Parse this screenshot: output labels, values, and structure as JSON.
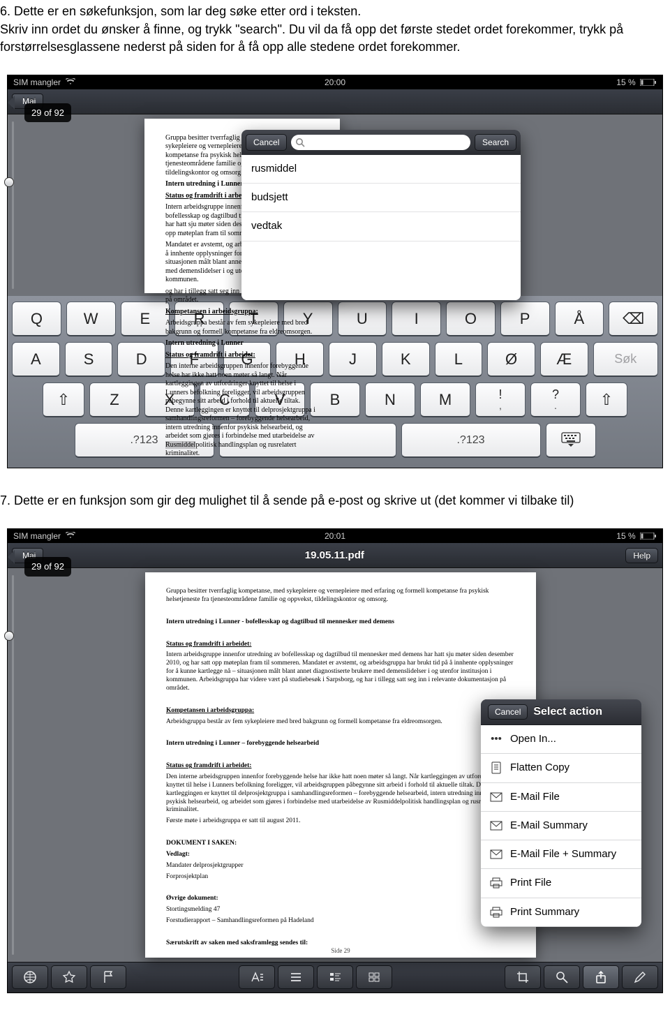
{
  "intro": {
    "line1": "6. Dette er en søkefunksjon, som lar deg søke etter ord i teksten.",
    "line2": "Skriv inn ordet du ønsker å finne, og trykk \"search\". Du vil da få opp det første stedet ordet forekommer, trykk på forstørrelsesglassene nederst på siden for å få opp alle stedene ordet forekommer."
  },
  "shot1": {
    "status": {
      "left": "SIM mangler",
      "center": "20:00",
      "right": "15 %"
    },
    "nav": {
      "back": "Mai",
      "title": "",
      "right": ""
    },
    "page_counter": "29 of 92",
    "search": {
      "cancel": "Cancel",
      "search": "Search",
      "placeholder": "",
      "suggestions": [
        "rusmiddel",
        "budsjett",
        "vedtak"
      ]
    },
    "doc": {
      "p1": "Gruppa besitter tverrfaglig kompetanse, med sykepleiere og vernepleiere med erfaring og formell kompetanse fra psykisk helsetjeneste fra tjenesteområdene familie og oppvekst, tildelingskontor og omsorg.",
      "h1": "Intern utredning i Lunner",
      "h2": "Status og framdrift i arbeidet:",
      "p2a": "Intern arbeidsgruppe innenfor utredning av bofellesskap og dagtilbud til mennesker med demens har hatt sju møter siden desember 2010, og har satt opp møteplan fram til sommeren.",
      "p2b": "Mandatet er avstemt, og arbeidsgruppa har brukt tid på å innhente opplysninger for å kunne kartlegge nå – situasjonen målt blant annet diagnostiserte brukere med demenslidelser i og utenfor institusjon i kommunen.",
      "p2c": "og har i tillegg satt seg inn i relevante dokumentasjon på området.",
      "h3": "Kompetansen i arbeidsgruppa:",
      "p3": "Arbeidsgruppa består av fem sykepleiere med bred bakgrunn og formell kompetanse fra eldreomsorgen.",
      "h4": "Intern utredning i Lunner",
      "h5": "Status og framdrift i arbeidet:",
      "p4a": "Den interne arbeidsgruppen innenfor forebyggende helse har ikke hatt noen møter så langt.",
      "p4b": "Når kartleggingen av utfordringer knyttet til helse i Lunners befolkning foreligger, vil arbeidsgruppen påbegynne sitt arbeid i forhold til aktuelle tiltak. Denne kartleggingen er knyttet til delprosjektgruppa i samhandlingsreformen – forebyggende helsearbeid, intern utredning innenfor psykisk helsearbeid, og arbeidet som gjøres i forbindelse med utarbeidelse av ",
      "hlword": "Rusmiddel",
      "p4c": "politisk handlingsplan og rusrelatert kriminalitet."
    },
    "keyboard": {
      "r1": [
        "Q",
        "W",
        "E",
        "R",
        "T",
        "Y",
        "U",
        "I",
        "O",
        "P",
        "Å"
      ],
      "bksp": "⌫",
      "r2": [
        "A",
        "S",
        "D",
        "F",
        "G",
        "H",
        "J",
        "K",
        "L",
        "Ø",
        "Æ"
      ],
      "sok": "Søk",
      "shift": "⇧",
      "r3": [
        "Z",
        "X",
        "C",
        "V",
        "B",
        "N",
        "M"
      ],
      "punct1_top": "!",
      "punct1_bot": ",",
      "punct2_top": "?",
      "punct2_bot": ".",
      "shift2": "⇧",
      "mode": ".?123",
      "hide": "⌨"
    }
  },
  "mid": {
    "line": "7. Dette er en funksjon som gir deg mulighet til å sende på e-post og skrive ut (det kommer vi tilbake til)"
  },
  "shot2": {
    "status": {
      "left": "SIM mangler",
      "center": "20:01",
      "right": "15 %"
    },
    "nav": {
      "back": "Mai",
      "title": "19.05.11.pdf",
      "right": "Help"
    },
    "page_counter": "29 of 92",
    "doc": {
      "p1": "Gruppa besitter tverrfaglig kompetanse, med sykepleiere og vernepleiere med erfaring og formell kompetanse fra psykisk helsetjeneste fra tjenesteområdene familie og oppvekst, tildelingskontor og omsorg.",
      "h1": "Intern utredning i Lunner - bofellesskap og dagtilbud til mennesker med demens",
      "h2": "Status og framdrift i arbeidet:",
      "p2": "Intern arbeidsgruppe innenfor utredning av bofellesskap og dagtilbud til mennesker med demens har hatt sju møter siden desember 2010, og har satt opp møteplan fram til sommeren. Mandatet er avstemt, og arbeidsgruppa har brukt tid på å innhente opplysninger for å kunne kartlegge nå – situasjonen målt blant annet diagnostiserte brukere med demenslidelser i og utenfor institusjon i kommunen. Arbeidsgruppa har videre vært på studiebesøk i Sarpsborg, og har i tillegg satt seg inn i relevante dokumentasjon på området.",
      "h3": "Kompetansen i arbeidsgruppa:",
      "p3": "Arbeidsgruppa består av fem sykepleiere med bred bakgrunn og formell kompetanse fra eldreomsorgen.",
      "h4": "Intern utredning i Lunner – forebyggende helsearbeid",
      "h5": "Status og framdrift i arbeidet:",
      "p4": "Den interne arbeidsgruppen innenfor forebyggende helse har ikke hatt noen møter så langt. Når kartleggingen av utfordringer knyttet til helse i Lunners befolkning foreligger, vil arbeidsgruppen påbegynne sitt arbeid i forhold til aktuelle tiltak. Denne kartleggingen er knyttet til delprosjektgruppa i samhandlingsreformen – forebyggende helsearbeid, intern utredning innenfor psykisk helsearbeid, og arbeidet som gjøres i forbindelse med utarbeidelse av Rusmiddelpolitisk handlingsplan og rusrelatert kriminalitet.",
      "p4b": "Første møte i arbeidsgruppa er satt til august 2011.",
      "h6": "DOKUMENT I SAKEN:",
      "h7": "Vedlagt:",
      "l1": "Mandater delprosjektgrupper",
      "l2": "Forprosjektplan",
      "h8": "Øvrige dokument:",
      "l3": "Stortingsmelding 47",
      "l4": "Forstudierapport – Samhandlingsreformen på Hadeland",
      "h9": "Særutskrift av saken med saksframlegg sendes til:",
      "pnum": "Side 29"
    },
    "action_sheet": {
      "cancel": "Cancel",
      "title": "Select action",
      "items": [
        {
          "icon": "dots",
          "label": "Open In..."
        },
        {
          "icon": "doc",
          "label": "Flatten Copy"
        },
        {
          "icon": "mail",
          "label": "E-Mail File"
        },
        {
          "icon": "mail",
          "label": "E-Mail Summary"
        },
        {
          "icon": "mail",
          "label": "E-Mail File + Summary"
        },
        {
          "icon": "print",
          "label": "Print File"
        },
        {
          "icon": "print",
          "label": "Print Summary"
        }
      ]
    }
  }
}
